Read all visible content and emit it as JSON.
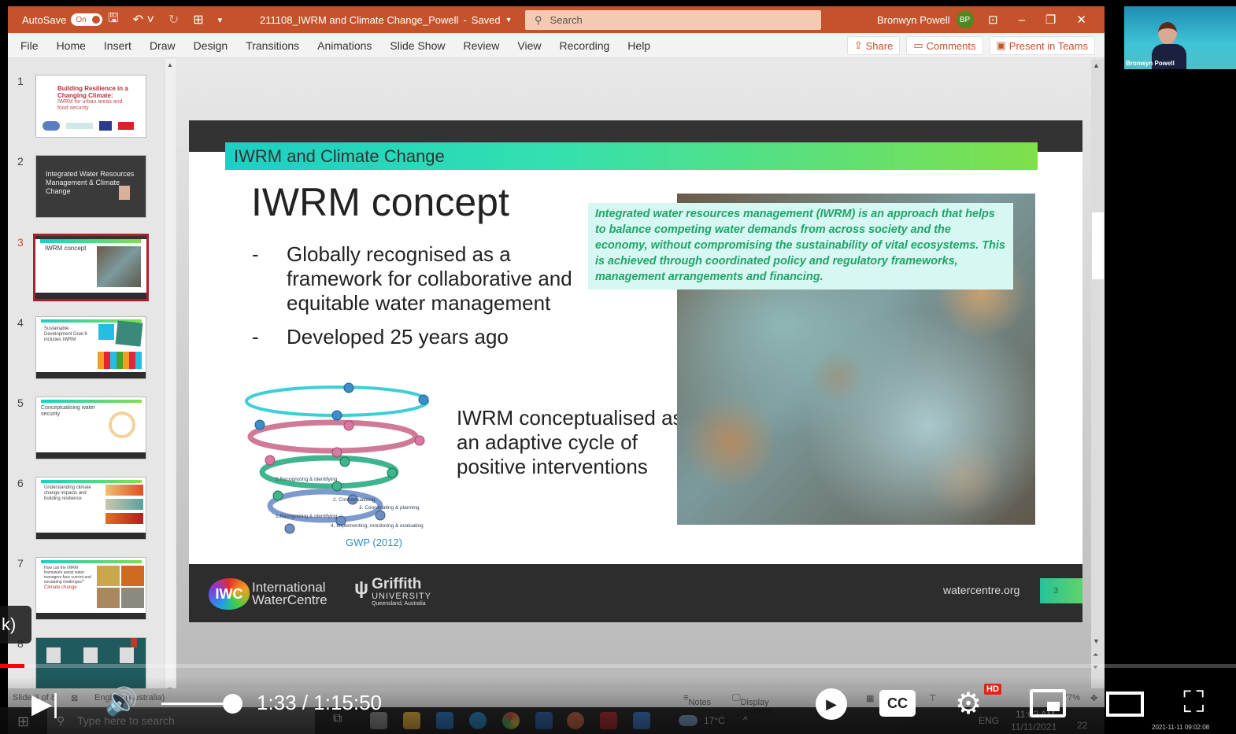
{
  "window": {
    "autosave_label": "AutoSave",
    "autosave_state": "On",
    "document_title": "211108_IWRM and Climate Change_Powell",
    "save_status": "Saved",
    "search_placeholder": "Search",
    "user_name": "Bronwyn Powell",
    "user_initials": "BP"
  },
  "ribbon": {
    "tabs": [
      "File",
      "Home",
      "Insert",
      "Draw",
      "Design",
      "Transitions",
      "Animations",
      "Slide Show",
      "Review",
      "View",
      "Recording",
      "Help"
    ],
    "share_label": "Share",
    "comments_label": "Comments",
    "present_label": "Present in Teams"
  },
  "thumbnails": [
    {
      "number": "1",
      "title": "Building Resilience in a Changing Climate:",
      "subtitle": "IWRM for urban areas and food security",
      "active": false
    },
    {
      "number": "2",
      "title": "Integrated Water Resources Management & Climate Change",
      "active": false
    },
    {
      "number": "3",
      "title": "IWRM concept",
      "active": true
    },
    {
      "number": "4",
      "title": "Sustainable Development Goal 6 includes IWRM",
      "active": false
    },
    {
      "number": "5",
      "title": "Conceptualising water security",
      "active": false
    },
    {
      "number": "6",
      "title": "Understanding climate change impacts and building resilience",
      "active": false
    },
    {
      "number": "7",
      "title": "How can the IWRM framework assist water managers face current and escalating challenges?",
      "subtitle": "Climate change",
      "active": false
    },
    {
      "number": "8",
      "title": "",
      "active": false
    }
  ],
  "slide": {
    "banner": "IWRM and Climate Change",
    "heading": "IWRM concept",
    "bullets": [
      "Globally recognised as a framework for collaborative and equitable water management",
      "Developed 25 years ago"
    ],
    "bullet_marker": "-",
    "definition": "Integrated water resources management (IWRM) is an approach that helps to balance competing water demands from across society and the economy, without compromising the sustainability of vital ecosystems. This is achieved through coordinated policy and regulatory frameworks, management arrangements and financing.",
    "spiral_caption": "IWRM conceptualised as an adaptive cycle of positive interventions",
    "spiral_labels": [
      "5.Recognizing & identifying",
      "2. Conceptualizing",
      "3. Coordinating & planning",
      "1.Recognizing & identifying",
      "4. Implementing, monitoring & evaluating"
    ],
    "source": "GWP (2012)",
    "footer": {
      "iwc_abbr": "IWC",
      "iwc_line1": "International",
      "iwc_line2": "WaterCentre",
      "griffith_name": "Griffith",
      "griffith_uni": "UNIVERSITY",
      "griffith_loc": "Queensland, Australia",
      "url": "watercentre.org",
      "slide_number": "3"
    }
  },
  "statusbar": {
    "slide_info": "Slide 3 of 8",
    "language": "English (Australia)",
    "notes_label": "Notes",
    "display_settings_label": "Display Settings",
    "zoom": "77%"
  },
  "taskbar": {
    "search_placeholder": "Type here to search",
    "weather": "17°C",
    "lang": "ENG",
    "time": "11:02 AM",
    "date": "11/11/2021",
    "notifications": "22"
  },
  "video": {
    "webcam_name": "Bronwyn Powell",
    "caption_fragment": "k)",
    "current_time": "1:33",
    "duration": "1:15:50",
    "time_display": "1:33 / 1:15:50",
    "progress_fraction": 0.02,
    "volume_fraction": 1.0,
    "quality_badge": "HD",
    "cc_label": "CC",
    "recording_timestamp": "2021-11-11 09:02:08"
  }
}
